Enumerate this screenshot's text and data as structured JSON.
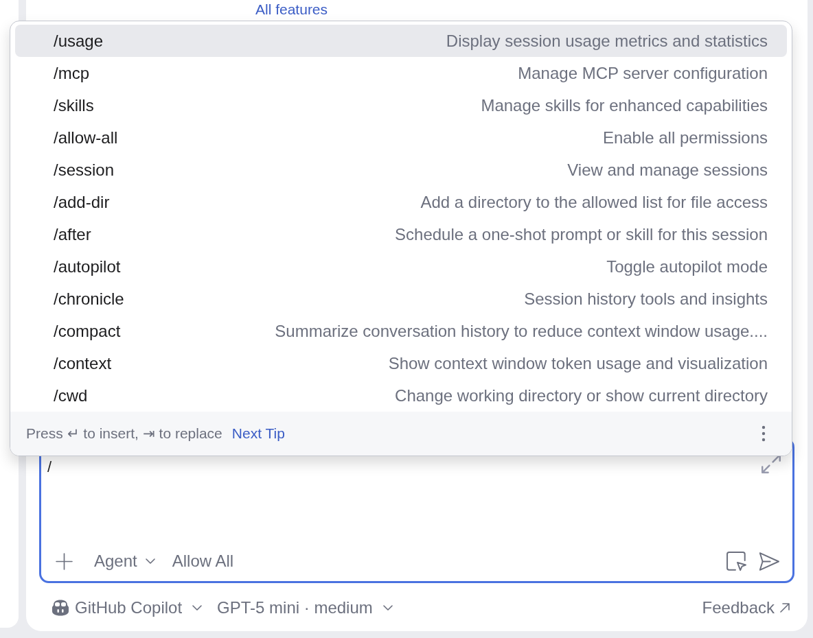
{
  "background": {
    "link": "All features"
  },
  "command_menu": {
    "items": [
      {
        "command": "/usage",
        "description": "Display session usage metrics and statistics",
        "selected": true
      },
      {
        "command": "/mcp",
        "description": "Manage MCP server configuration",
        "selected": false
      },
      {
        "command": "/skills",
        "description": "Manage skills for enhanced capabilities",
        "selected": false
      },
      {
        "command": "/allow-all",
        "description": "Enable all permissions",
        "selected": false
      },
      {
        "command": "/session",
        "description": "View and manage sessions",
        "selected": false
      },
      {
        "command": "/add-dir",
        "description": "Add a directory to the allowed list for file access",
        "selected": false
      },
      {
        "command": "/after",
        "description": "Schedule a one-shot prompt or skill for this session",
        "selected": false
      },
      {
        "command": "/autopilot",
        "description": "Toggle autopilot mode",
        "selected": false
      },
      {
        "command": "/chronicle",
        "description": "Session history tools and insights",
        "selected": false
      },
      {
        "command": "/compact",
        "description": "Summarize conversation history to reduce context window usage....",
        "selected": false
      },
      {
        "command": "/context",
        "description": "Show context window token usage and visualization",
        "selected": false
      },
      {
        "command": "/cwd",
        "description": "Change working directory or show current directory",
        "selected": false
      }
    ],
    "hint": "Press ↵ to insert, ⇥ to replace",
    "tip_link": "Next Tip"
  },
  "composer": {
    "value": "/",
    "mode": "Agent",
    "permissions": "Allow All"
  },
  "footer": {
    "agent": "GitHub Copilot",
    "model": "GPT-5 mini · medium",
    "feedback": "Feedback"
  }
}
